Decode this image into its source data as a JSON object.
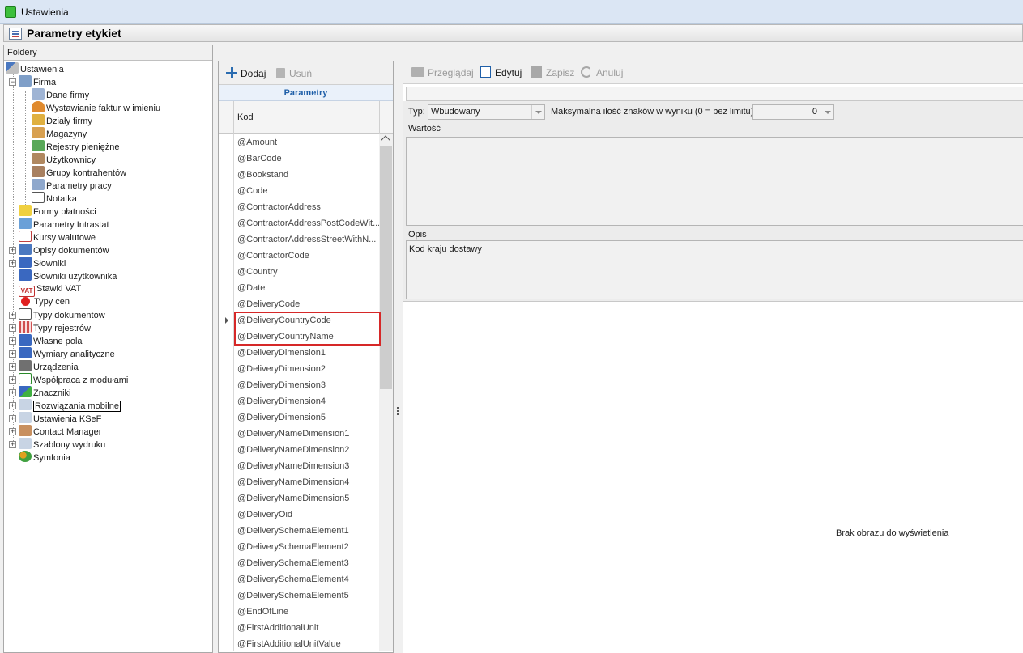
{
  "window": {
    "title": "Ustawienia"
  },
  "header": {
    "title": "Parametry etykiet"
  },
  "folders": {
    "header": "Foldery",
    "root": "Ustawienia",
    "firma": {
      "label": "Firma",
      "children": [
        "Dane firmy",
        "Wystawianie faktur w imieniu",
        "Działy firmy",
        "Magazyny",
        "Rejestry pieniężne",
        "Użytkownicy",
        "Grupy kontrahentów",
        "Parametry pracy",
        "Notatka"
      ]
    },
    "items": [
      "Formy płatności",
      "Parametry Intrastat",
      "Kursy walutowe",
      "Opisy dokumentów",
      "Słowniki",
      "Słowniki użytkownika",
      "Stawki VAT",
      "Typy cen",
      "Typy dokumentów",
      "Typy rejestrów",
      "Własne pola",
      "Wymiary analityczne",
      "Urządzenia",
      "Współpraca z modułami",
      "Znaczniki",
      "Rozwiązania mobilne",
      "Ustawienia KSeF",
      "Contact Manager",
      "Szablony wydruku",
      "Symfonia"
    ],
    "vat_badge": "VAT"
  },
  "params_toolbar": {
    "add": "Dodaj",
    "delete": "Usuń"
  },
  "params_grid": {
    "group_header": "Parametry",
    "column_header": "Kod",
    "rows": [
      "@Amount",
      "@BarCode",
      "@Bookstand",
      "@Code",
      "@ContractorAddress",
      "@ContractorAddressPostCodeWit...",
      "@ContractorAddressStreetWithN...",
      "@ContractorCode",
      "@Country",
      "@Date",
      "@DeliveryCode",
      "@DeliveryCountryCode",
      "@DeliveryCountryName",
      "@DeliveryDimension1",
      "@DeliveryDimension2",
      "@DeliveryDimension3",
      "@DeliveryDimension4",
      "@DeliveryDimension5",
      "@DeliveryNameDimension1",
      "@DeliveryNameDimension2",
      "@DeliveryNameDimension3",
      "@DeliveryNameDimension4",
      "@DeliveryNameDimension5",
      "@DeliveryOid",
      "@DeliverySchemaElement1",
      "@DeliverySchemaElement2",
      "@DeliverySchemaElement3",
      "@DeliverySchemaElement4",
      "@DeliverySchemaElement5",
      "@EndOfLine",
      "@FirstAdditionalUnit",
      "@FirstAdditionalUnitValue"
    ],
    "current_row": "@DeliveryCountryCode",
    "highlighted_rows": [
      "@DeliveryCountryCode",
      "@DeliveryCountryName"
    ]
  },
  "detail_toolbar": {
    "browse": "Przeglądaj",
    "edit": "Edytuj",
    "save": "Zapisz",
    "cancel": "Anuluj"
  },
  "detail": {
    "type_label": "Typ:",
    "type_value": "Wbudowany",
    "max_label": "Maksymalna ilość znaków w wyniku (0 = bez limitu):",
    "max_value": "0",
    "value_label": "Wartość",
    "value_text": "",
    "desc_label": "Opis",
    "desc_text": "Kod kraju dostawy",
    "no_image": "Brak obrazu do wyświetlenia"
  },
  "colors": {
    "accent": "#1f5fa8",
    "highlight_border": "#d62828"
  }
}
